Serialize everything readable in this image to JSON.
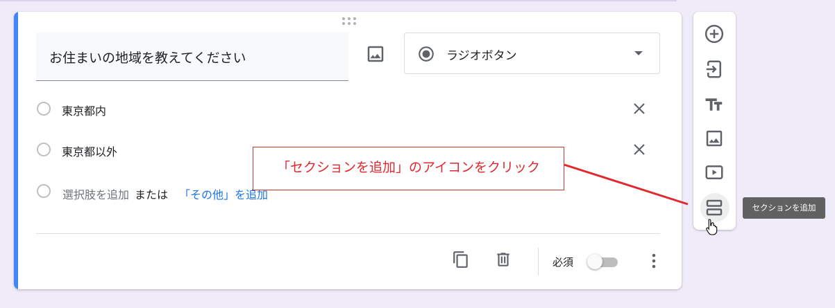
{
  "question": {
    "title": "お住まいの地域を教えてください",
    "type_label": "ラジオボタン"
  },
  "options": [
    {
      "label": "東京都内"
    },
    {
      "label": "東京都以外"
    }
  ],
  "add_option": {
    "add_label": "選択肢を追加",
    "or_label": "または",
    "other_link": "「その他」を追加"
  },
  "footer": {
    "required_label": "必須",
    "required_on": false
  },
  "callout": {
    "text": "「セクションを追加」のアイコンをクリック",
    "color": "#e0282e"
  },
  "toolbar": {
    "items": [
      {
        "icon": "add-circle-icon"
      },
      {
        "icon": "import-icon"
      },
      {
        "icon": "title-text-icon"
      },
      {
        "icon": "image-icon"
      },
      {
        "icon": "video-icon"
      },
      {
        "icon": "section-icon"
      }
    ],
    "tooltip": "セクションを追加"
  },
  "colors": {
    "accent": "#4285f4",
    "background": "#f0ebf8",
    "link": "#1a73e8"
  }
}
